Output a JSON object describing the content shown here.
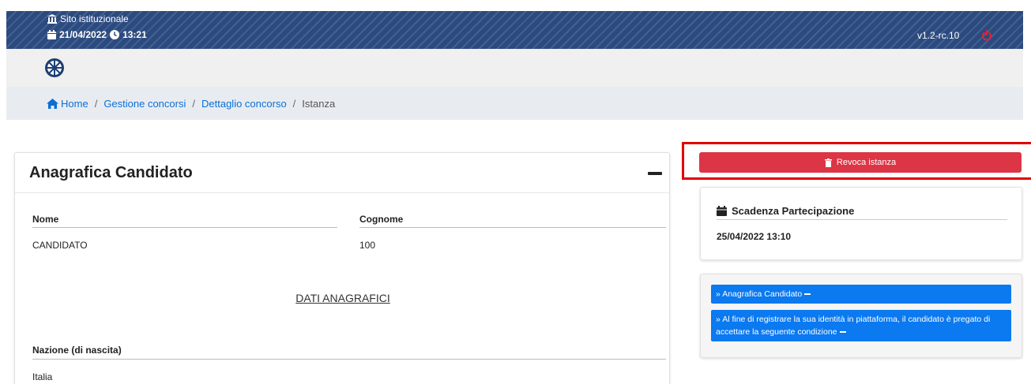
{
  "topbar": {
    "site_label": "Sito istituzionale",
    "date": "21/04/2022",
    "time": "13:21",
    "version": "v1.2-rc.10",
    "icons": [
      "institution-icon",
      "calendar-icon",
      "clock-icon",
      "power-icon"
    ],
    "colors": {
      "background": "#2b4a7f",
      "power": "#e0243a"
    }
  },
  "breadcrumb": {
    "items": [
      "Home",
      "Gestione concorsi",
      "Dettaglio concorso",
      "Istanza"
    ]
  },
  "main_card": {
    "title": "Anagrafica Candidato",
    "fields": {
      "nome_label": "Nome",
      "nome_value": "CANDIDATO",
      "cognome_label": "Cognome",
      "cognome_value": "100"
    },
    "section_heading": "DATI ANAGRAFICI",
    "nazione_label": "Nazione (di nascita)",
    "nazione_value": "Italia"
  },
  "sidebar": {
    "revoke_label": "Revoca istanza",
    "deadline_title": "Scadenza Partecipazione",
    "deadline_value": "25/04/2022 13:10",
    "links": [
      "Anagrafica Candidato",
      "Al fine di registrare la sua identità in piattaforma, il candidato è pregato di accettare la seguente condizione"
    ],
    "colors": {
      "revoke": "#dc3545",
      "link": "#0b79f0",
      "highlight": "#e30000"
    }
  }
}
